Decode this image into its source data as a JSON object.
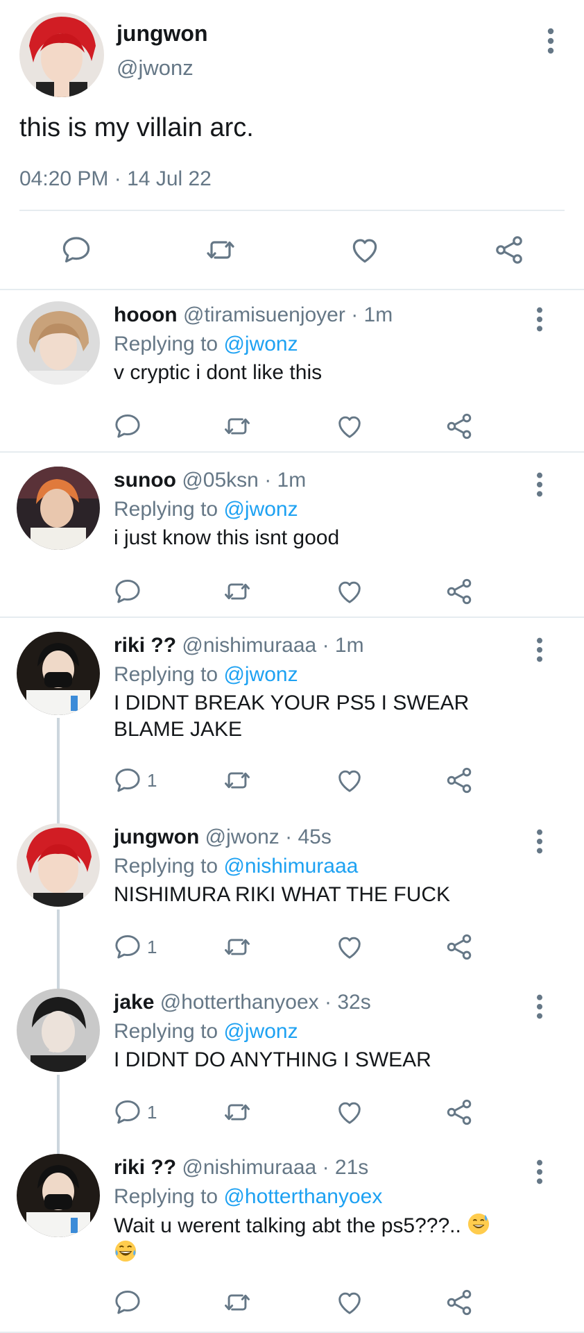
{
  "main_tweet": {
    "name": "jungwon",
    "handle": "@jwonz",
    "text": "this is my villain arc.",
    "time": "04:20 PM",
    "separator": "·",
    "date": "14 Jul 22",
    "actions": [
      "comment-icon",
      "retweet-icon",
      "like-icon",
      "share-icon"
    ]
  },
  "replies": [
    {
      "name": "hooon",
      "handle": "@tiramisuenjoyer",
      "dot": "·",
      "time": "1m",
      "replying_prefix": "Replying to",
      "replying_to": "@jwonz",
      "text_lines": [
        "v cryptic i dont like this"
      ],
      "reply_count": ""
    },
    {
      "name": "sunoo",
      "handle": "@05ksn",
      "dot": "·",
      "time": "1m",
      "replying_prefix": "Replying to",
      "replying_to": "@jwonz",
      "text_lines": [
        "i just know this isnt good"
      ],
      "reply_count": ""
    },
    {
      "name": "riki ??",
      "handle": "@nishimuraaa",
      "dot": "·",
      "time": "1m",
      "replying_prefix": "Replying to",
      "replying_to": "@jwonz",
      "text_lines": [
        "I DIDNT BREAK YOUR PS5 I SWEAR",
        "BLAME JAKE"
      ],
      "reply_count": "1"
    },
    {
      "name": "jungwon",
      "handle": "@jwonz",
      "dot": "·",
      "time": "45s",
      "replying_prefix": "Replying to",
      "replying_to": "@nishimuraaa",
      "text_lines": [
        "NISHIMURA RIKI WHAT THE FUCK"
      ],
      "reply_count": "1"
    },
    {
      "name": "jake",
      "handle": "@hotterthanyoex",
      "dot": "·",
      "time": "32s",
      "replying_prefix": "Replying to",
      "replying_to": "@jwonz",
      "text_lines": [
        "I DIDNT DO ANYTHING I SWEAR"
      ],
      "reply_count": "1"
    },
    {
      "name": "riki ??",
      "handle": "@nishimuraaa",
      "dot": "·",
      "time": "21s",
      "replying_prefix": "Replying to",
      "replying_to": "@hotterthanyoex",
      "text_lines": [
        "Wait u werent talking abt the ps5???.."
      ],
      "emojis": [
        "grinning-sweat-emoji",
        "tears-of-joy-emoji"
      ],
      "reply_count": ""
    }
  ],
  "colors": {
    "text": "#14171a",
    "muted": "#657786",
    "link": "#1da1f2",
    "divider": "#e6ecf0",
    "thread_line": "#ccd6dd"
  }
}
